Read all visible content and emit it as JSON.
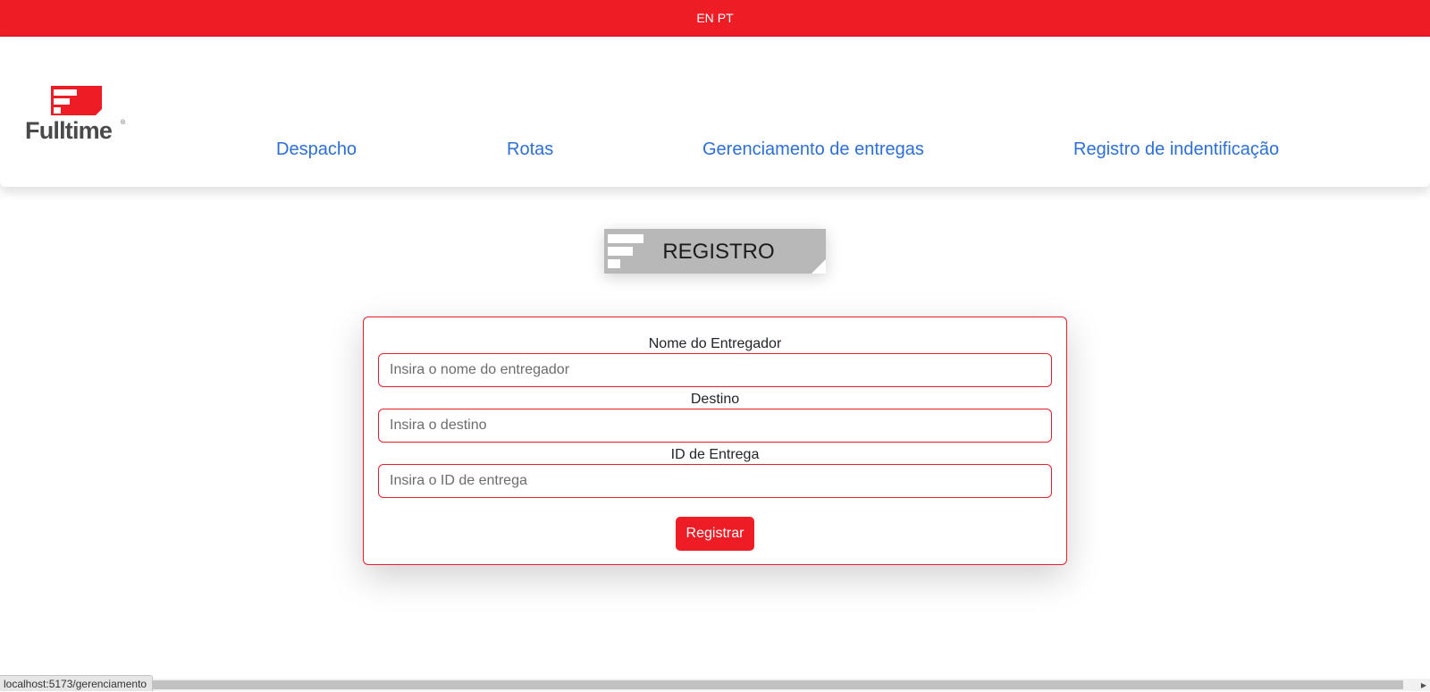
{
  "topbar": {
    "lang_en": "EN",
    "lang_pt": "PT"
  },
  "brand": {
    "name": "Fulltime",
    "registered": "®"
  },
  "nav": {
    "items": [
      {
        "label": "Despacho"
      },
      {
        "label": "Rotas"
      },
      {
        "label": "Gerenciamento de entregas"
      },
      {
        "label": "Registro de indentificação"
      }
    ]
  },
  "banner": {
    "title": "REGISTRO"
  },
  "form": {
    "fields": [
      {
        "label": "Nome do Entregador",
        "placeholder": "Insira o nome do entregador",
        "value": ""
      },
      {
        "label": "Destino",
        "placeholder": "Insira o destino",
        "value": ""
      },
      {
        "label": "ID de Entrega",
        "placeholder": "Insira o ID de entrega",
        "value": ""
      }
    ],
    "submit_label": "Registrar"
  },
  "status_bar": {
    "url": "localhost:5173/gerenciamento"
  },
  "colors": {
    "brand_red": "#ee1c25",
    "link_blue": "#2d6fd6",
    "logo_gray": "#4a4a4a"
  }
}
